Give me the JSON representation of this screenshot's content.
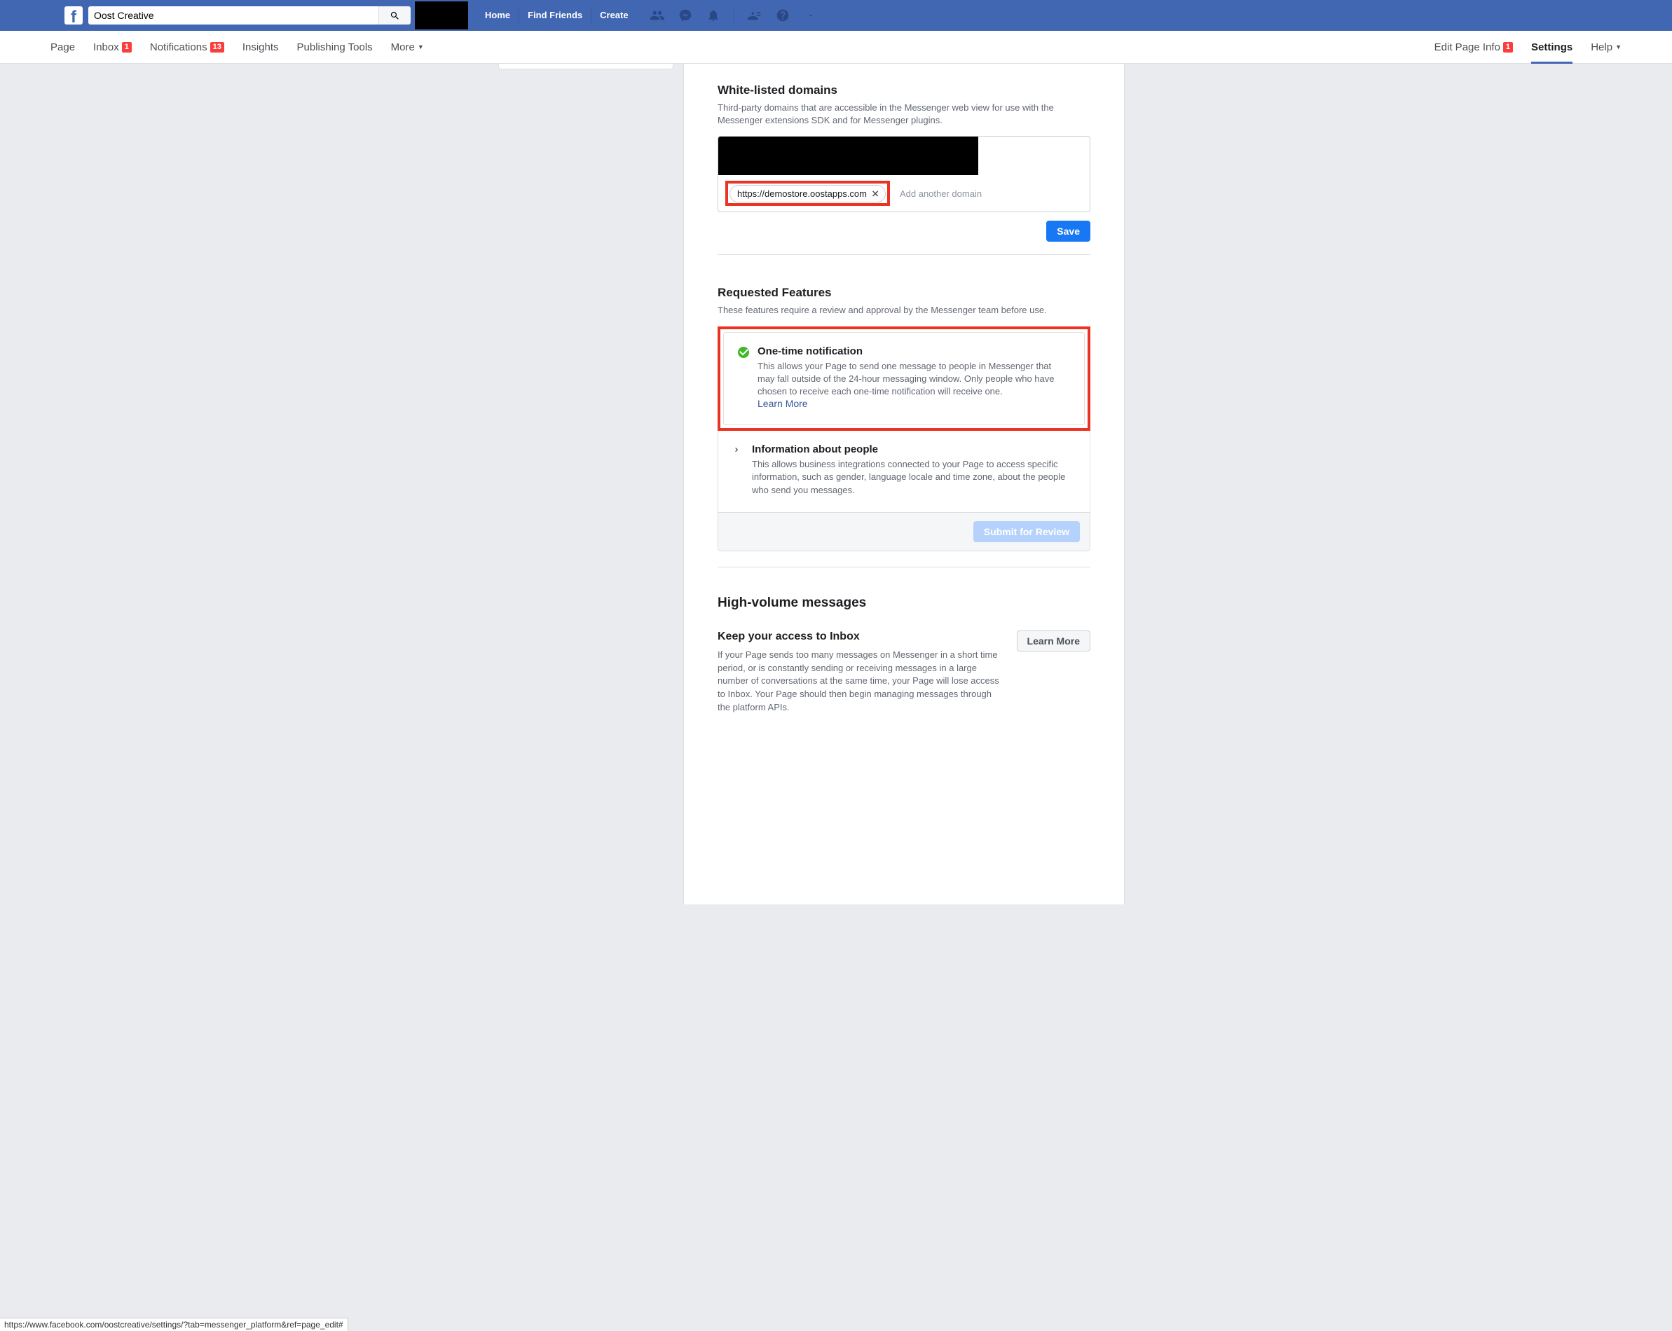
{
  "search": {
    "value": "Oost Creative"
  },
  "topnav": {
    "home": "Home",
    "find_friends": "Find Friends",
    "create": "Create"
  },
  "pagebar": {
    "page": "Page",
    "inbox": "Inbox",
    "inbox_badge": "1",
    "notifications": "Notifications",
    "notifications_badge": "13",
    "insights": "Insights",
    "publishing": "Publishing Tools",
    "more": "More",
    "edit_info": "Edit Page Info",
    "edit_badge": "1",
    "settings": "Settings",
    "help": "Help"
  },
  "whitelist": {
    "title": "White-listed domains",
    "desc": "Third-party domains that are accessible in the Messenger web view for use with the Messenger extensions SDK and for Messenger plugins.",
    "chip": "https://demostore.oostapps.com",
    "placeholder": "Add another domain",
    "save": "Save"
  },
  "requested": {
    "title": "Requested Features",
    "desc": "These features require a review and approval by the Messenger team before use.",
    "item1": {
      "title": "One-time notification",
      "desc": "This allows your Page to send one message to people in Messenger that may fall outside of the 24-hour messaging window. Only people who have chosen to receive each one-time notification will receive one.",
      "learn": "Learn More"
    },
    "item2": {
      "title": "Information about people",
      "desc": "This allows business integrations connected to your Page to access specific information, such as gender, language locale and time zone, about the people who send you messages."
    },
    "submit": "Submit for Review"
  },
  "hv": {
    "title": "High-volume messages",
    "subtitle": "Keep your access to Inbox",
    "desc": "If your Page sends too many messages on Messenger in a short time period, or is constantly sending or receiving messages in a large number of conversations at the same time, your Page will lose access to Inbox. Your Page should then begin managing messages through the platform APIs.",
    "learn": "Learn More"
  },
  "status_url": "https://www.facebook.com/oostcreative/settings/?tab=messenger_platform&ref=page_edit#"
}
